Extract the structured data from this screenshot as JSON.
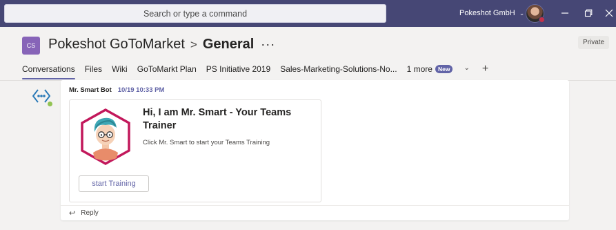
{
  "titlebar": {
    "search_placeholder": "Search or type a command",
    "org_name": "Pokeshot GmbH",
    "colors": {
      "bar": "#464775",
      "presence_busy": "#c4314b"
    }
  },
  "header": {
    "team_initials": "CS",
    "team_name": "Pokeshot GoToMarket",
    "separator": ">",
    "channel_name": "General",
    "more": "···",
    "privacy": "Private"
  },
  "tabs": [
    {
      "label": "Conversations",
      "active": true
    },
    {
      "label": "Files"
    },
    {
      "label": "Wiki"
    },
    {
      "label": "GoToMarkt Plan"
    },
    {
      "label": "PS Initiative 2019"
    },
    {
      "label": "Sales-Marketing-Solutions-No..."
    }
  ],
  "more_tabs": {
    "label": "1 more",
    "badge": "New"
  },
  "message": {
    "author": "Mr. Smart Bot",
    "time": "10/19 10:33 PM",
    "card": {
      "title": "Hi, I am Mr. Smart - Your Teams Trainer",
      "subtitle": "Click Mr. Smart to start your Teams Training",
      "button": "start Training"
    },
    "reply": "Reply"
  },
  "icons": [
    "chevron-down-icon",
    "minimize-icon",
    "maximize-icon",
    "close-icon",
    "plus-icon",
    "bot-icon",
    "reply-icon"
  ]
}
